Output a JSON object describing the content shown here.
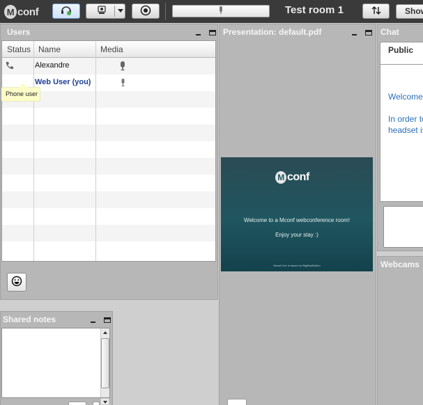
{
  "topbar": {
    "logo_text": "conf",
    "logo_mark": "M",
    "room_title": "Test room 1",
    "show_label": "Show",
    "icons": {
      "headset": "headset-icon",
      "webcam": "webcam-icon",
      "record": "record-icon",
      "microphone": "microphone-icon",
      "layout": "layout-arrows-icon"
    }
  },
  "users": {
    "title": "Users",
    "columns": [
      "Status",
      "Name",
      "Media"
    ],
    "rows": [
      {
        "name": "Alexandre",
        "status_icon": "phone-icon",
        "media_icon": "microphone-icon"
      },
      {
        "name": "Web User (you)",
        "status_icon": "",
        "media_icon": "microphone-icon"
      }
    ],
    "tooltip": "Phone user",
    "emoji_icon": "emoji-icon"
  },
  "shared_notes": {
    "title": "Shared notes"
  },
  "presentation": {
    "title": "Presentation: default.pdf",
    "slide": {
      "logo_mark": "M",
      "logo_text": "conf",
      "line1": "Welcome to a Mconf webconference room!",
      "line2": "Enjoy your stay :)",
      "footer": "Mconf Live is based on BigBlueButton"
    }
  },
  "chat": {
    "title": "Chat",
    "tab_public": "Public",
    "messages": [
      "Welcome",
      "In order to",
      "headset is"
    ]
  },
  "webcams": {
    "title": "Webcams"
  },
  "colors": {
    "topbar": "#3a3a3a",
    "panel": "#b7b7b7",
    "link_blue": "#2a6fb8",
    "you_blue": "#1c3f94",
    "slide_teal": "#1f5660"
  }
}
